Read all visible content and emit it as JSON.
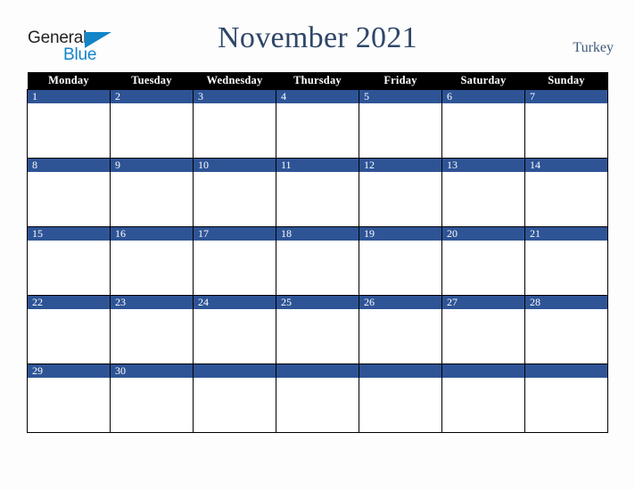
{
  "logo": {
    "name": "general-blue-logo",
    "text_top": "General",
    "text_bottom": "Blue",
    "color_dark": "#231f20",
    "color_blue": "#1284c8",
    "triangle_icon": "triangle-icon"
  },
  "header": {
    "title": "November 2021",
    "locale": "Turkey",
    "title_color": "#2f4668",
    "locale_color": "#40597c"
  },
  "calendar": {
    "accent_color": "#2e5496",
    "header_bg": "#000000",
    "header_fg": "#ffffff",
    "weekdays": [
      "Monday",
      "Tuesday",
      "Wednesday",
      "Thursday",
      "Friday",
      "Saturday",
      "Sunday"
    ],
    "weeks": [
      [
        "1",
        "2",
        "3",
        "4",
        "5",
        "6",
        "7"
      ],
      [
        "8",
        "9",
        "10",
        "11",
        "12",
        "13",
        "14"
      ],
      [
        "15",
        "16",
        "17",
        "18",
        "19",
        "20",
        "21"
      ],
      [
        "22",
        "23",
        "24",
        "25",
        "26",
        "27",
        "28"
      ],
      [
        "29",
        "30",
        "",
        "",
        "",
        "",
        ""
      ]
    ]
  }
}
